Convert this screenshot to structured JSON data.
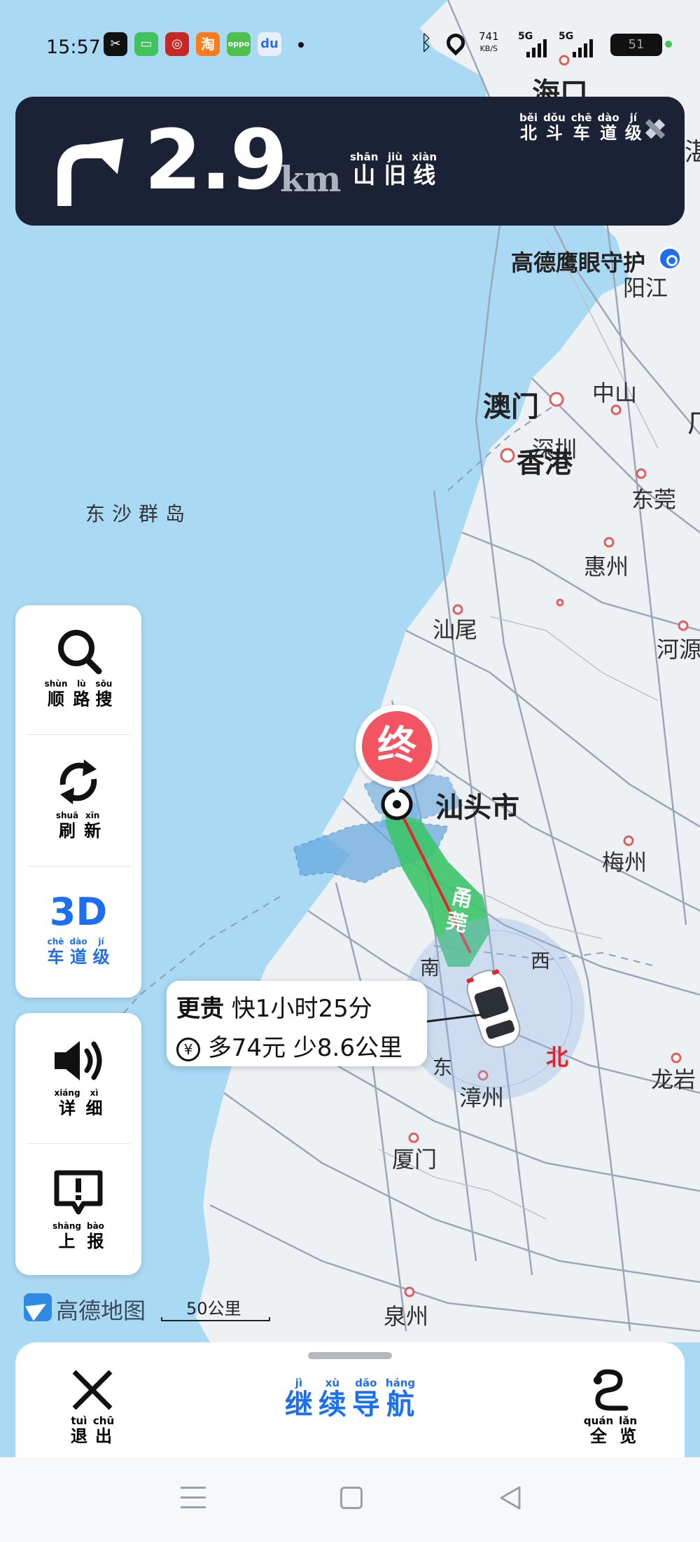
{
  "status_bar": {
    "time": "15:57",
    "apps": [
      "CapCut",
      "消息",
      "中国银行",
      "淘",
      "oppo",
      "百度"
    ],
    "net_speed": "741",
    "net_unit": "KB/S",
    "signal1": "5G",
    "signal2": "5G",
    "battery": "51"
  },
  "nav": {
    "distance": "2.9",
    "unit": "km",
    "road": [
      [
        "shān",
        "山"
      ],
      [
        "jiù",
        "旧"
      ],
      [
        "xiàn",
        "线"
      ]
    ],
    "lane_level": [
      [
        "běi",
        "北"
      ],
      [
        "dǒu",
        "斗"
      ],
      [
        "chē",
        "车"
      ],
      [
        "dào",
        "道"
      ],
      [
        "jí",
        "级"
      ]
    ]
  },
  "map": {
    "labels": {
      "haikou": "海口",
      "eagle_eye": "高德鹰眼守护",
      "yangjiang": "阳江",
      "macau": "澳门",
      "zhongshan": "中山",
      "shenzhen": "深圳",
      "hongkong": "香港",
      "dongguan": "东莞",
      "dongsha": "东沙群岛",
      "huizhou": "惠州",
      "shanwei": "汕尾",
      "heyuan": "河源",
      "shantou": "汕头市",
      "meizhou": "梅州",
      "south": "南",
      "west": "西",
      "east": "东",
      "north": "北",
      "zhangzhou": "漳州",
      "longyan": "龙岩",
      "xiamen": "厦门",
      "quanzhou": "泉州",
      "road_shield": "甬莞",
      "destination": "终",
      "partial_edge_1": "湛",
      "partial_edge_2": "广"
    },
    "logo": "高德地图",
    "scale": "50公里"
  },
  "side_panel": {
    "search": [
      [
        "shùn",
        "顺"
      ],
      [
        "lù",
        "路"
      ],
      [
        "sōu",
        "搜"
      ]
    ],
    "refresh": [
      [
        "shuā",
        "刷"
      ],
      [
        "xīn",
        "新"
      ]
    ],
    "mode": "3D",
    "mode_label": [
      [
        "chē",
        "车"
      ],
      [
        "dào",
        "道"
      ],
      [
        "jí",
        "级"
      ]
    ],
    "detail": [
      [
        "xiáng",
        "详"
      ],
      [
        "xì",
        "细"
      ]
    ],
    "report": [
      [
        "shàng",
        "上"
      ],
      [
        "bào",
        "报"
      ]
    ]
  },
  "route_card": {
    "tag": "更贵",
    "time_diff": "快1小时25分",
    "cost_diff": "多74元 少8.6公里"
  },
  "bottom": {
    "exit": [
      [
        "tuì",
        "退"
      ],
      [
        "chū",
        "出"
      ]
    ],
    "continue": [
      [
        "jì",
        "继"
      ],
      [
        "xù",
        "续"
      ],
      [
        "dǎo",
        "导"
      ],
      [
        "háng",
        "航"
      ]
    ],
    "overview": [
      [
        "quán",
        "全"
      ],
      [
        "lǎn",
        "览"
      ]
    ]
  },
  "colors": {
    "nav_bg": "#1c2235",
    "accent_blue": "#1d6ff2",
    "route_green": "#3cc46a",
    "destination_red": "#f25461",
    "route_red": "#e3262b"
  }
}
